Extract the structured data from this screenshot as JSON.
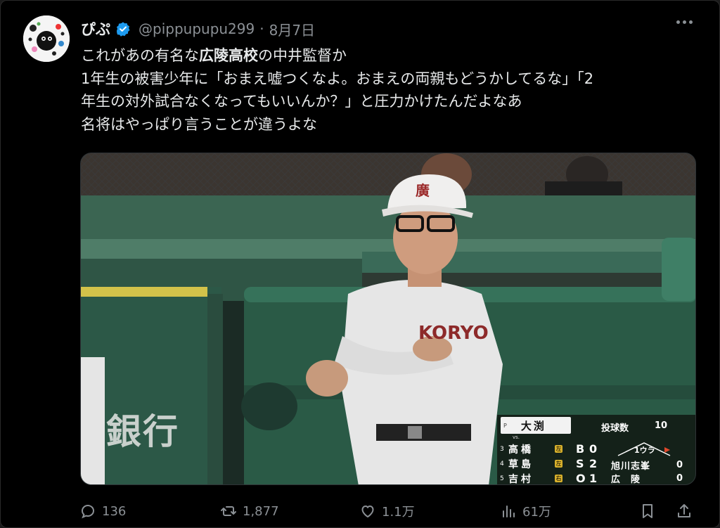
{
  "author": {
    "display_name": "ぴぷ",
    "handle": "@pippupupu299",
    "separator": "·",
    "date": "8月7日"
  },
  "post": {
    "lines": [
      [
        "これがあの有名な",
        "広陵高校",
        "の中井監督か"
      ],
      "1年生の被害少年に「おまえ嘘つくなよ。おまえの両親もどうかしてるな」「2",
      "年生の対外試合なくなってもいいんか？」と圧力かけたんだよなあ",
      "名将はやっぱり言うことが違うよな"
    ]
  },
  "media": {
    "watermark": "銀行",
    "scoreboard": {
      "pitcher_tag": "P",
      "pitcher_name": "大渕",
      "vs": "vs.",
      "pitch_count_label": "投球数",
      "pitch_count": "10",
      "lineup": [
        {
          "num": "3",
          "name": "高橋",
          "hand": "左"
        },
        {
          "num": "4",
          "name": "草島",
          "hand": "左"
        },
        {
          "num": "5",
          "name": "吉村",
          "hand": "右"
        }
      ],
      "bso_labels": [
        "B",
        "S",
        "O"
      ],
      "bso_values": [
        "0",
        "2",
        "1"
      ],
      "inning": "1ウラ",
      "teams": [
        {
          "name": "旭川志峯",
          "score": "0"
        },
        {
          "name": "広　陵",
          "score": "0"
        }
      ]
    },
    "jersey_text": "KORYO",
    "cap_logo": "廣"
  },
  "actions": {
    "replies": "136",
    "reposts": "1,877",
    "likes": "1.1万",
    "views": "61万"
  }
}
